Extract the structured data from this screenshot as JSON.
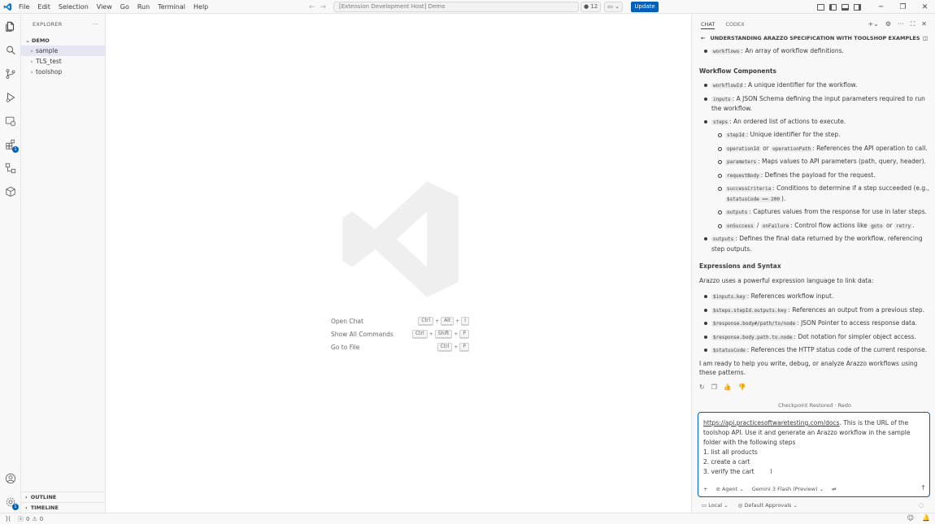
{
  "titlebar": {
    "menu": [
      "File",
      "Edit",
      "Selection",
      "View",
      "Go",
      "Run",
      "Terminal",
      "Help"
    ],
    "command_center": "[Extension Development Host] Demo",
    "problems_count": "12",
    "update_label": "Update"
  },
  "activity": {
    "extensions_badge": "1",
    "settings_badge": "1"
  },
  "sidebar": {
    "title": "EXPLORER",
    "more": "···",
    "root": "DEMO",
    "items": [
      {
        "label": "sample"
      },
      {
        "label": "TLS_test"
      },
      {
        "label": "toolshop"
      }
    ],
    "outline": "OUTLINE",
    "timeline": "TIMELINE"
  },
  "editor": {
    "shortcuts": [
      {
        "label": "Open Chat",
        "keys": [
          "Ctrl",
          "Alt",
          "I"
        ]
      },
      {
        "label": "Show All Commands",
        "keys": [
          "Ctrl",
          "Shift",
          "P"
        ]
      },
      {
        "label": "Go to File",
        "keys": [
          "Ctrl",
          "P"
        ]
      }
    ]
  },
  "chat": {
    "tabs": {
      "chat": "CHAT",
      "codex": "CODEX"
    },
    "title": "UNDERSTANDING ARAZZO SPECIFICATION WITH TOOLSHOP EXAMPLES",
    "intro_item": {
      "code": "workflows",
      "text": ": An array of workflow definitions."
    },
    "workflow_heading": "Workflow Components",
    "wc": {
      "workflowId": {
        "code": "workflowId",
        "text": ": A unique identifier for the workflow."
      },
      "inputs": {
        "code": "inputs",
        "text": ": A JSON Schema defining the input parameters required to run the workflow."
      },
      "steps": {
        "code": "steps",
        "text": ": An ordered list of actions to execute."
      },
      "stepId": {
        "code": "stepId",
        "text": ": Unique identifier for the step."
      },
      "operationId": {
        "code": "operationId",
        "or": " or ",
        "code2": "operationPath",
        "text": ": References the API operation to call."
      },
      "parameters": {
        "code": "parameters",
        "text": ": Maps values to API parameters (path, query, header)."
      },
      "requestBody": {
        "code": "requestBody",
        "text": ": Defines the payload for the request."
      },
      "successCriteria": {
        "code": "successCriteria",
        "text": ": Conditions to determine if a step succeeded (e.g., ",
        "code2": "$statusCode == 200",
        "text2": ")."
      },
      "outputs_step": {
        "code": "outputs",
        "text": ": Captures values from the response for use in later steps."
      },
      "flow": {
        "code": "onSuccess",
        "sep": " / ",
        "code2": "onFailure",
        "text": ": Control flow actions like ",
        "code3": "goto",
        "or": " or ",
        "code4": "retry",
        "end": "."
      },
      "outputs_wf": {
        "code": "outputs",
        "text": ": Defines the final data returned by the workflow, referencing step outputs."
      }
    },
    "expr_heading": "Expressions and Syntax",
    "expr_intro": "Arazzo uses a powerful expression language to link data:",
    "expr": [
      {
        "code": "$inputs.key",
        "text": ": References workflow input."
      },
      {
        "code": "$steps.stepId.outputs.key",
        "text": ": References an output from a previous step."
      },
      {
        "code": "$response.body#/path/to/node",
        "text": ": JSON Pointer to access response data."
      },
      {
        "code": "$response.body.path.to.node",
        "text": ": Dot notation for simpler object access."
      },
      {
        "code": "$statusCode",
        "text": ": References the HTTP status code of the current response."
      }
    ],
    "closing": "I am ready to help you write, debug, or analyze Arazzo workflows using these patterns.",
    "checkpoint": "Checkpoint Restored",
    "checkpoint_sep": "·",
    "redo": "Redo",
    "input": {
      "link": "https://api.practicesoftwaretesting.com/docs",
      "line1_rest": ".  This is the URL of the toolshop API. Use it and generate an Arazzo workflow in the sample folder with the following steps",
      "steps": [
        "1. list all products",
        "2. create a cart",
        "3. verify the cart"
      ]
    },
    "toolbar": {
      "agent": "Agent",
      "model": "Gemini 3 Flash (Preview)"
    },
    "footer": {
      "local": "Local",
      "approvals": "Default Approvals"
    }
  },
  "status": {
    "errors": "0",
    "warnings": "0"
  }
}
